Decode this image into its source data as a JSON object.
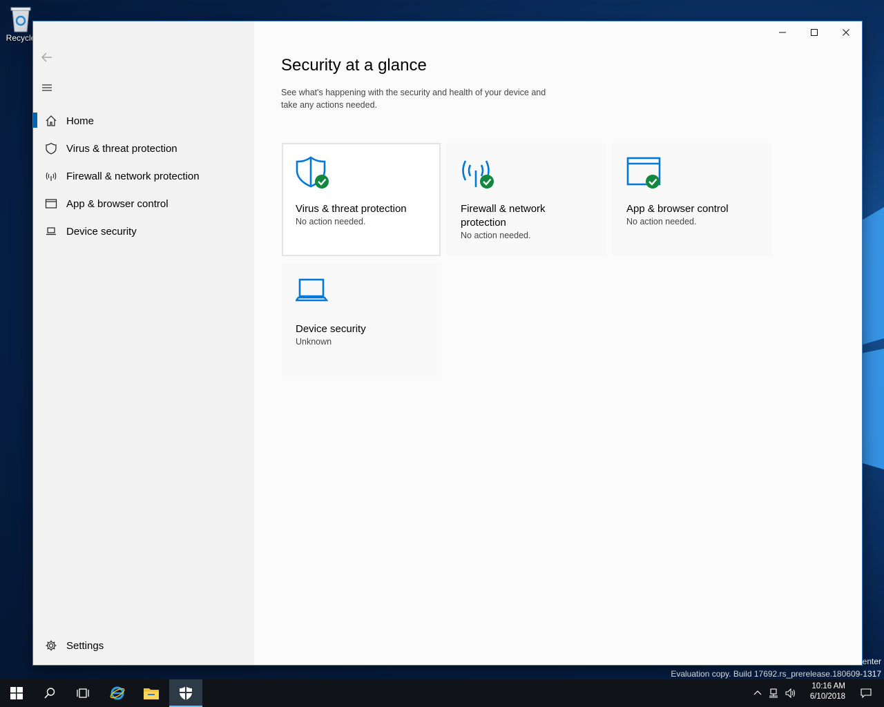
{
  "desktop": {
    "recycle_bin_label": "Recycle",
    "watermark_line1": "enter",
    "watermark_line2": "Evaluation copy. Build 17692.rs_prerelease.180609-1317"
  },
  "window": {
    "back_icon": "back-arrow-icon",
    "menu_icon": "hamburger-icon",
    "controls": {
      "minimize": "minimize-icon",
      "maximize": "maximize-icon",
      "close": "close-icon"
    }
  },
  "nav": {
    "items": [
      {
        "label": "Home",
        "icon": "home-icon",
        "active": true
      },
      {
        "label": "Virus & threat protection",
        "icon": "shield-icon"
      },
      {
        "label": "Firewall & network protection",
        "icon": "antenna-icon"
      },
      {
        "label": "App & browser control",
        "icon": "browser-window-icon"
      },
      {
        "label": "Device security",
        "icon": "laptop-icon"
      }
    ],
    "settings_label": "Settings"
  },
  "main": {
    "title": "Security at a glance",
    "subtitle": "See what's happening with the security and health of your device and take any actions needed.",
    "tiles": [
      {
        "title": "Virus & threat protection",
        "status": "No action needed.",
        "icon": "shield-check-icon"
      },
      {
        "title": "Firewall & network protection",
        "status": "No action needed.",
        "icon": "antenna-check-icon"
      },
      {
        "title": "App & browser control",
        "status": "No action needed.",
        "icon": "browser-check-icon"
      },
      {
        "title": "Device security",
        "status": "Unknown",
        "icon": "laptop-icon"
      }
    ]
  },
  "taskbar": {
    "time": "10:16 AM",
    "date": "6/10/2018"
  },
  "colors": {
    "accent": "#0063b1",
    "check_green": "#10893e",
    "icon_blue": "#0078d7"
  }
}
